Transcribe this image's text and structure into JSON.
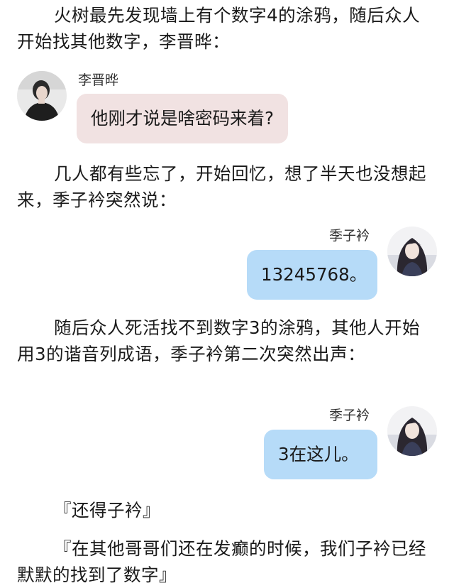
{
  "paragraphs": {
    "p1": "火树最先发现墙上有个数字4的涂鸦，随后众人开始找其他数字，李晋晔：",
    "p2": "几人都有些忘了，开始回忆，想了半天也没想起来，季子衿突然说：",
    "p3": "随后众人死活找不到数字3的涂鸦，其他人开始用3的谐音列成语，季子衿第二次突然出声："
  },
  "messages": [
    {
      "sender": "李晋晔",
      "text": "他刚才说是啥密码来着?",
      "side": "left",
      "bubble_color": "#f1e2e2"
    },
    {
      "sender": "季子衿",
      "text": "13245768。",
      "side": "right",
      "bubble_color": "#b6dbf8"
    },
    {
      "sender": "季子衿",
      "text": "3在这儿。",
      "side": "right",
      "bubble_color": "#b6dbf8"
    }
  ],
  "quotes": {
    "q1": "『还得子衿』",
    "q2": "『在其他哥哥们还在发癫的时候，我们子衿已经默默的找到了数字』"
  }
}
